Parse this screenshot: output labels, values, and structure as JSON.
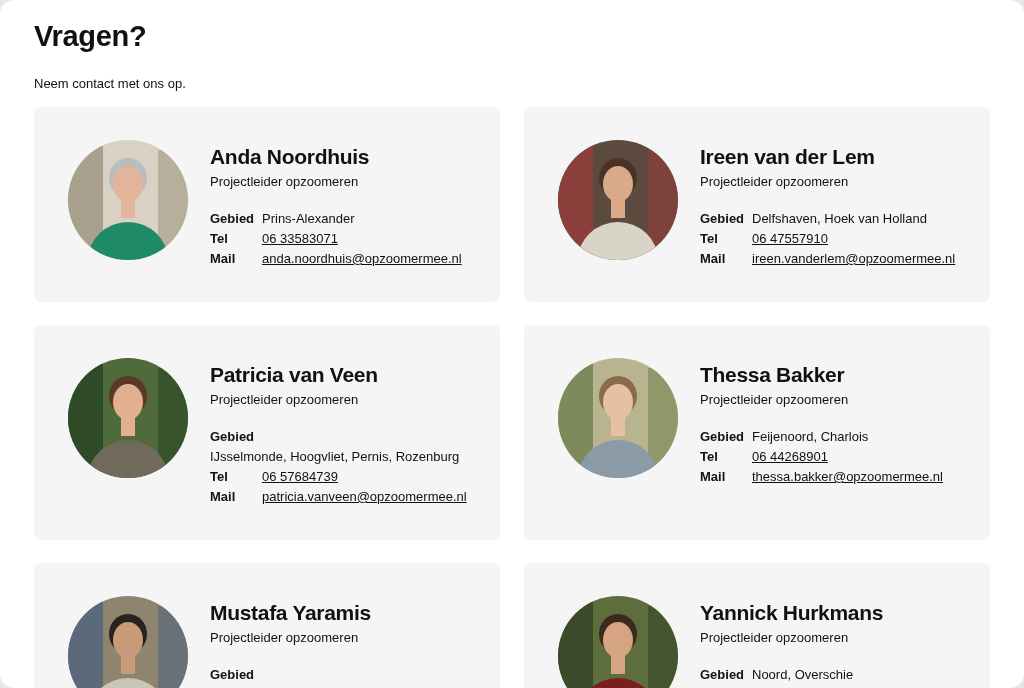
{
  "heading": "Vragen?",
  "intro": "Neem contact met ons op.",
  "contacts": [
    {
      "name": "Anda Noordhuis",
      "role": "Projectleider opzoomeren",
      "area_label": "Gebied",
      "area": "Prins-Alexander",
      "tel_label": "Tel",
      "tel": "06 33583071",
      "mail_label": "Mail",
      "mail": "anda.noordhuis@opzoomermee.nl"
    },
    {
      "name": "Ireen van der Lem",
      "role": "Projectleider opzoomeren",
      "area_label": "Gebied",
      "area": "Delfshaven, Hoek van Holland",
      "tel_label": "Tel",
      "tel": "06 47557910",
      "mail_label": "Mail",
      "mail": "ireen.vanderlem@opzoomermee.nl"
    },
    {
      "name": "Patricia van Veen",
      "role": "Projectleider opzoomeren",
      "area_label": "Gebied",
      "area": "IJsselmonde, Hoogvliet, Pernis, Rozenburg",
      "tel_label": "Tel",
      "tel": "06 57684739",
      "mail_label": "Mail",
      "mail": "patricia.vanveen@opzoomermee.nl"
    },
    {
      "name": "Thessa Bakker",
      "role": "Projectleider opzoomeren",
      "area_label": "Gebied",
      "area": "Feijenoord, Charlois",
      "tel_label": "Tel",
      "tel": "06 44268901",
      "mail_label": "Mail",
      "mail": "thessa.bakker@opzoomermee.nl"
    },
    {
      "name": "Mustafa Yaramis",
      "role": "Projectleider opzoomeren",
      "area_label": "Gebied"
    },
    {
      "name": "Yannick Hurkmans",
      "role": "Projectleider opzoomeren",
      "area_label": "Gebied",
      "area": "Noord, Overschie"
    }
  ]
}
